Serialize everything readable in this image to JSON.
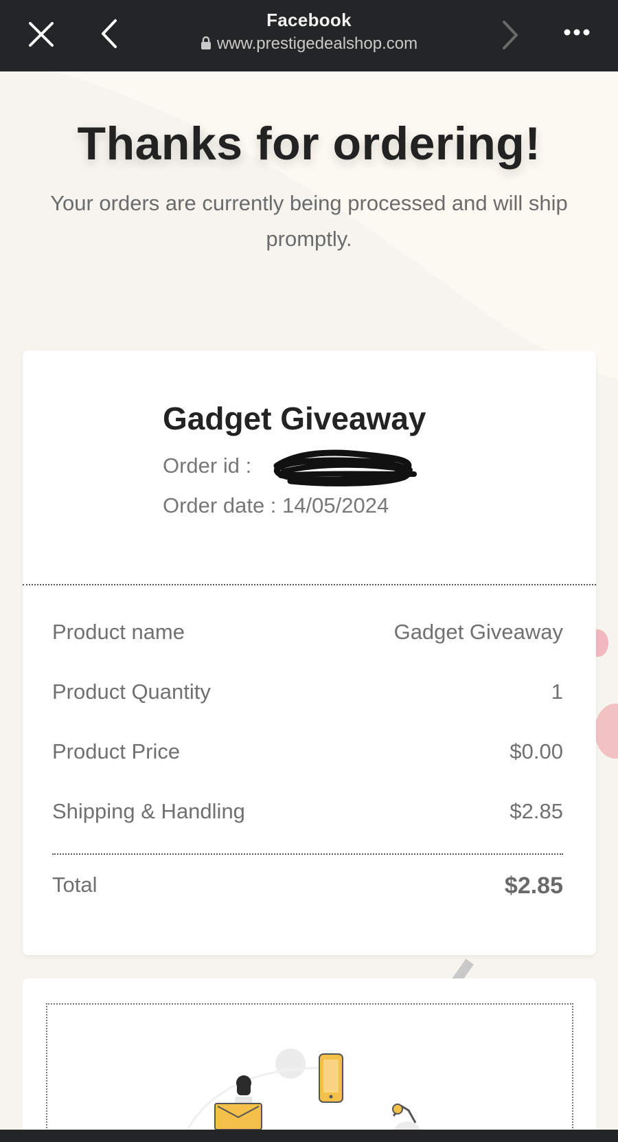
{
  "browser": {
    "title": "Facebook",
    "url": "www.prestigedealshop.com",
    "icons": [
      "close-icon",
      "back-icon",
      "forward-icon",
      "more-icon",
      "lock-icon"
    ]
  },
  "hero": {
    "title": "Thanks for ordering!",
    "subtitle": "Your orders are currently being processed and will ship promptly."
  },
  "order": {
    "title": "Gadget Giveaway",
    "id_label": "Order id :",
    "date_label": "Order date : 14/05/2024",
    "rows": [
      {
        "label": "Product name",
        "value": "Gadget Giveaway"
      },
      {
        "label": "Product Quantity",
        "value": "1"
      },
      {
        "label": "Product Price",
        "value": "$0.00"
      },
      {
        "label": "Shipping & Handling",
        "value": "$2.85"
      }
    ],
    "total": {
      "label": "Total",
      "value": "$2.85"
    }
  },
  "colors": {
    "topbar": "#242526",
    "page_bg": "#f6f4ee",
    "accent_yellow": "#f5c04a"
  }
}
